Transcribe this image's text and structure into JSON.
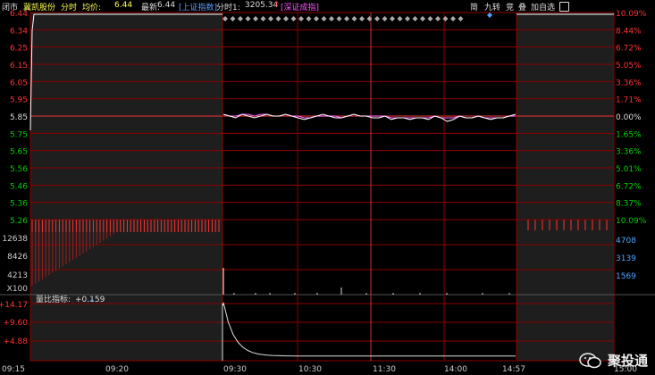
{
  "header": {
    "status": "闭市",
    "stock_name": "冀凯股份",
    "time_label": "分时",
    "avg_label": "均价:",
    "avg_value": "6.44",
    "last_label": "最新:",
    "last_value": "6.44",
    "index1": "[上证指数]",
    "index_label": "分时1:",
    "index_value": "3205.34",
    "index_arrow": "↑",
    "index2": "[深证成指]"
  },
  "toolbar": {
    "jian": "简",
    "jiuzhuan": "九转",
    "jing": "竞",
    "die": "叠",
    "add_watch": "加自选"
  },
  "indicator": {
    "name": "量比指标:",
    "value": "+0.159",
    "arrow": "↓"
  },
  "colors": {
    "up": "#ff3232",
    "down": "#00d000",
    "grid": "#8b0000",
    "price_line": "#ffffff",
    "avg_line": "#ff66ff",
    "axis_right_pct": "#ff3232",
    "volume_axis": "#4aa3ff"
  },
  "chart_data": {
    "type": "line",
    "price_axis": {
      "ticks_up": [
        "6.44",
        "6.34",
        "6.25",
        "6.15",
        "6.05",
        "5.95"
      ],
      "base": "5.85",
      "ticks_down": [
        "5.75",
        "5.65",
        "5.56",
        "5.46",
        "5.36",
        "5.26"
      ],
      "pct_up": [
        "10.09%",
        "8.44%",
        "6.72%",
        "5.05%",
        "3.36%",
        "1.71%"
      ],
      "pct_base": "0.00%",
      "pct_down": [
        "1.65%",
        "3.36%",
        "5.01%",
        "6.72%",
        "8.37%",
        "10.09%"
      ]
    },
    "volume_axis": {
      "left": [
        "12638",
        "8426",
        "4213",
        "X100"
      ],
      "right": [
        "4708",
        "3139",
        "1569"
      ]
    },
    "indicator_axis": [
      "+14.17",
      "+9.60",
      "+4.88"
    ],
    "time_axis": [
      "09:15",
      "09:20",
      "09:30",
      "10:30",
      "11:30",
      "14:00",
      "14:57",
      "15:00"
    ],
    "price_series": [
      5.86,
      5.85,
      5.84,
      5.86,
      5.85,
      5.84,
      5.85,
      5.86,
      5.85,
      5.85,
      5.86,
      5.85,
      5.84,
      5.83,
      5.84,
      5.85,
      5.86,
      5.85,
      5.84,
      5.84,
      5.85,
      5.86,
      5.85,
      5.85,
      5.84,
      5.84,
      5.85,
      5.83,
      5.84,
      5.84,
      5.83,
      5.84,
      5.84,
      5.83,
      5.85,
      5.84,
      5.82,
      5.83,
      5.85,
      5.84,
      5.84,
      5.85,
      5.84,
      5.83,
      5.84,
      5.84,
      5.85,
      5.86
    ],
    "avg_series": [
      5.86,
      5.85,
      5.85,
      5.86,
      5.86,
      5.85,
      5.86,
      5.86,
      5.85,
      5.85,
      5.86,
      5.85,
      5.85,
      5.84,
      5.84,
      5.85,
      5.85,
      5.85,
      5.85,
      5.84,
      5.85,
      5.86,
      5.85,
      5.85,
      5.85,
      5.85,
      5.85,
      5.84,
      5.84,
      5.84,
      5.84,
      5.84,
      5.84,
      5.84,
      5.85,
      5.84,
      5.84,
      5.84,
      5.85,
      5.84,
      5.84,
      5.85,
      5.84,
      5.84,
      5.84,
      5.84,
      5.85,
      5.85
    ],
    "ylim_price": [
      5.26,
      6.44
    ],
    "ylim_volume": [
      0,
      12638
    ],
    "ylim_indicator": [
      0,
      14.17
    ],
    "grid": true
  },
  "watermark": {
    "text": "聚投通"
  }
}
